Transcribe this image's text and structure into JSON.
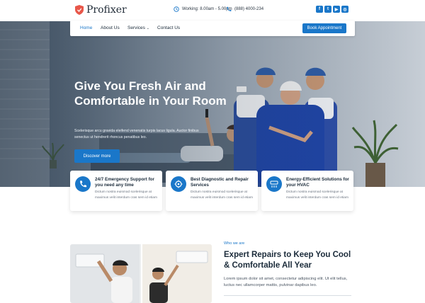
{
  "brand": {
    "name": "Profixer",
    "accent": "#1a77c9"
  },
  "topbar": {
    "hours": "Working: 8.00am - 5.00pm",
    "phone": "(888) 4000-234",
    "socials": [
      {
        "icon": "facebook-icon",
        "glyph": "f"
      },
      {
        "icon": "twitter-icon",
        "glyph": "t"
      },
      {
        "icon": "youtube-icon",
        "glyph": "▶"
      },
      {
        "icon": "instagram-icon",
        "glyph": "◎"
      }
    ]
  },
  "nav": {
    "items": [
      "Home",
      "About Us",
      "Services",
      "Contact Us"
    ],
    "active": "Home",
    "cta": "Book Appointment"
  },
  "hero": {
    "title": "Give You Fresh Air and Comfortable in Your Room",
    "text": "Scelerisque arcu gravida eleifend venenatis turpis lacus ligula. Auctor finibus senectus ut hendrerit rhoncus penatibus leo.",
    "button": "Discover more"
  },
  "features": [
    {
      "icon": "phone-icon",
      "title": "24/7 Emergency Support for you need any time",
      "text": "Dictum nostra euismod scelerisque at maximus velit interdum cras sem id etiam"
    },
    {
      "icon": "diagnostic-icon",
      "title": "Best Diagnostic and Repair Services",
      "text": "Dictum nostra euismod scelerisque at maximus velit interdum cras sem id etiam"
    },
    {
      "icon": "air-conditioner-icon",
      "title": "Energy-Efficient Solutions for your HVAC",
      "text": "Dictum nostra euismod scelerisque at maximus velit interdum cras sem id etiam"
    }
  ],
  "about": {
    "label": "Who we are",
    "title": "Expert Repairs to Keep You Cool & Comfortable All Year",
    "text": "Lorem ipsum dolor sit amet, consectetur adipiscing elit. Ut elit tellus, luctus nec ullamcorper mattis, pulvinar dapibus leo."
  }
}
